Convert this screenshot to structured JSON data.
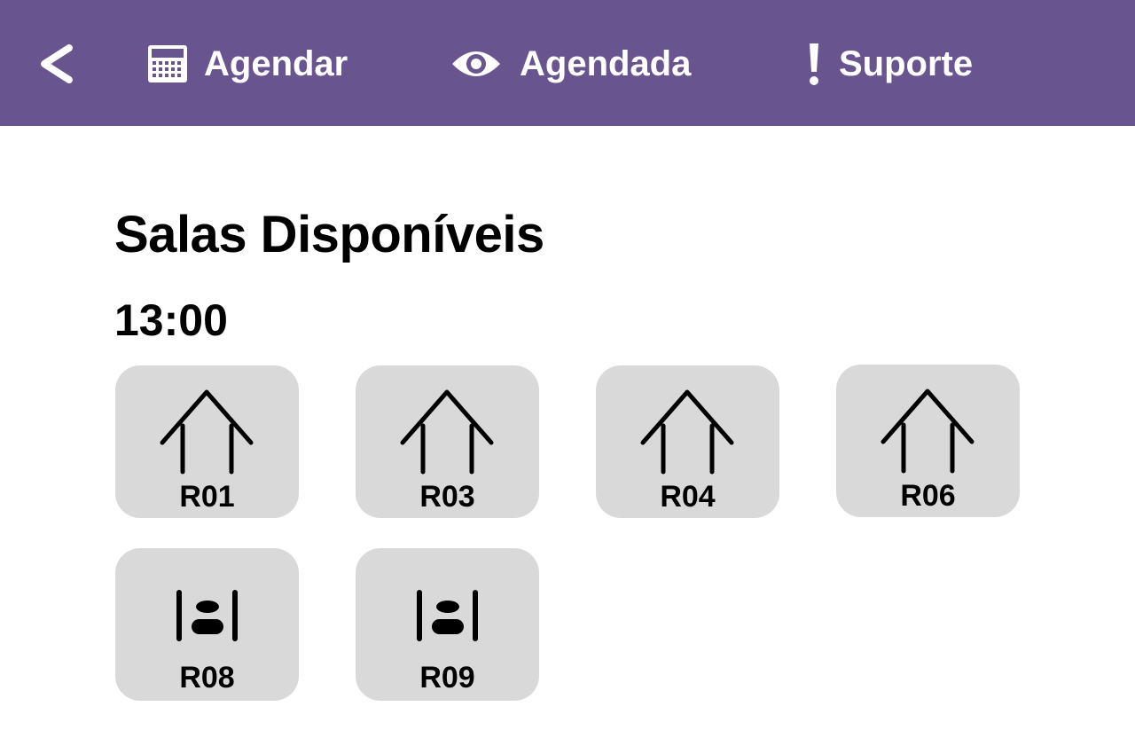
{
  "header": {
    "back_icon": "chevron-left-icon",
    "nav": [
      {
        "label": "Agendar",
        "icon": "calendar-icon"
      },
      {
        "label": "Agendada",
        "icon": "eye-icon"
      },
      {
        "label": "Suporte",
        "icon": "exclamation-icon"
      }
    ],
    "background_color": "#68548f"
  },
  "main": {
    "title": "Salas Disponíveis",
    "time": "13:00",
    "rooms": [
      {
        "label": "R01",
        "icon": "room-arch-icon"
      },
      {
        "label": "R03",
        "icon": "room-arch-icon"
      },
      {
        "label": "R04",
        "icon": "room-arch-icon"
      },
      {
        "label": "R06",
        "icon": "room-arch-icon"
      },
      {
        "label": "R08",
        "icon": "meeting-table-icon"
      },
      {
        "label": "R09",
        "icon": "meeting-table-icon"
      }
    ],
    "card_color": "#d9d9d9"
  }
}
